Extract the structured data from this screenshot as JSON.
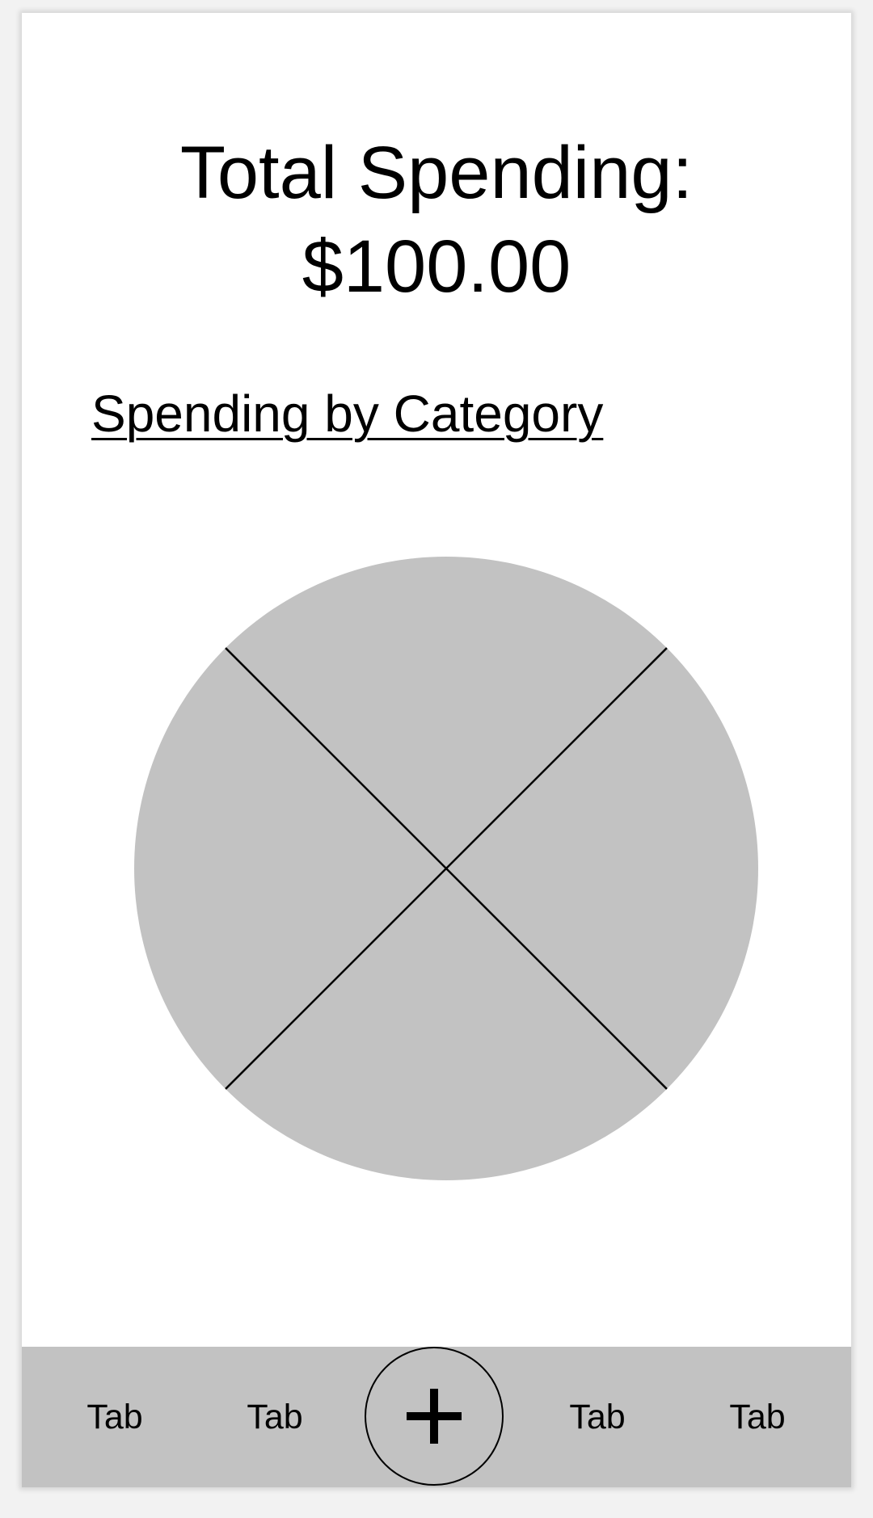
{
  "summary": {
    "total_label": "Total Spending:",
    "total_value": "$100.00"
  },
  "section": {
    "heading": "Spending by Category"
  },
  "chart_data": {
    "type": "pie",
    "values": [
      25,
      25,
      25,
      25
    ],
    "slice_color": "#c2c2c2",
    "divider_color": "#000000"
  },
  "tabbar": {
    "background": "#c2c2c2",
    "tabs": [
      {
        "label": "Tab"
      },
      {
        "label": "Tab"
      },
      {
        "label": "Tab"
      },
      {
        "label": "Tab"
      }
    ],
    "add_icon": "plus-icon"
  }
}
